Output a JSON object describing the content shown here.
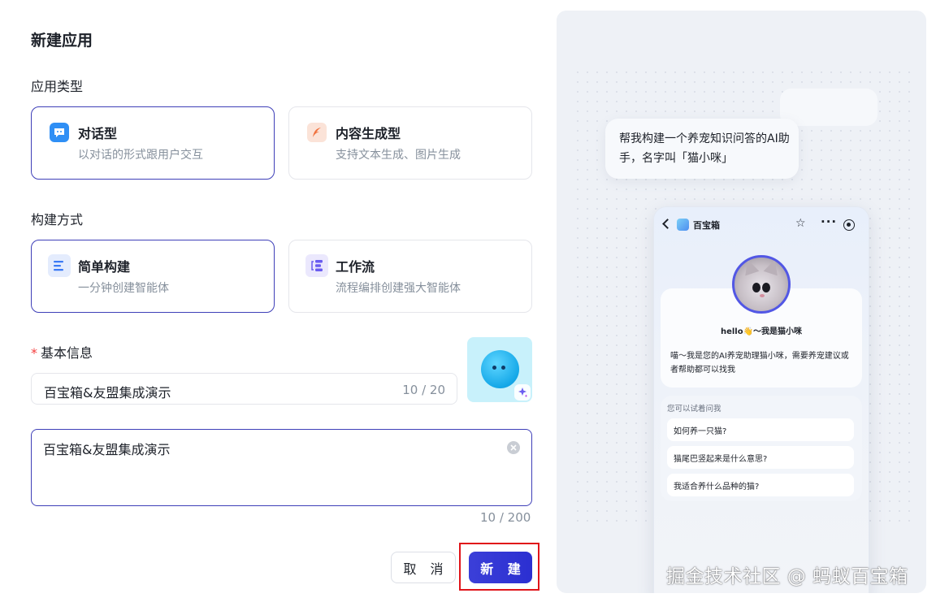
{
  "dialog": {
    "title": "新建应用"
  },
  "app_type": {
    "label": "应用类型",
    "options": [
      {
        "title": "对话型",
        "desc": "以对话的形式跟用户交互",
        "selected": true,
        "icon": "chat-icon",
        "color": "#2f8ff5"
      },
      {
        "title": "内容生成型",
        "desc": "支持文本生成、图片生成",
        "selected": false,
        "icon": "feather-icon",
        "color": "#f0703c"
      }
    ]
  },
  "build_mode": {
    "label": "构建方式",
    "options": [
      {
        "title": "简单构建",
        "desc": "一分钟创建智能体",
        "selected": true,
        "icon": "list-icon",
        "color": "#3b7af5"
      },
      {
        "title": "工作流",
        "desc": "流程编排创建强大智能体",
        "selected": false,
        "icon": "workflow-icon",
        "color": "#6a5cf0"
      }
    ]
  },
  "basic_info": {
    "label": "基本信息",
    "required_mark": "*",
    "name_value": "百宝箱&友盟集成演示",
    "name_count": "10 / 20",
    "desc_value": "百宝箱&友盟集成演示",
    "desc_count": "10 / 200"
  },
  "buttons": {
    "cancel": "取 消",
    "create": "新 建"
  },
  "preview": {
    "prompt": "帮我构建一个养宠知识问答的AI助手，名字叫「猫小咪」",
    "app_name": "百宝箱",
    "greeting": "hello👋～我是猫小咪",
    "intro": "喵～我是您的AI养宠助理猫小咪，需要养宠建议或者帮助都可以找我",
    "suggest_header": "您可以试着问我",
    "suggestions": [
      "如何养一只猫?",
      "猫尾巴竖起来是什么意思?",
      "我适合养什么品种的猫?"
    ]
  },
  "watermark": "掘金技术社区 @ 蚂蚁百宝箱",
  "colors": {
    "accent": "#3e3fb8",
    "primary_button": "#2b2fd1",
    "highlight_box": "#e0141a"
  }
}
